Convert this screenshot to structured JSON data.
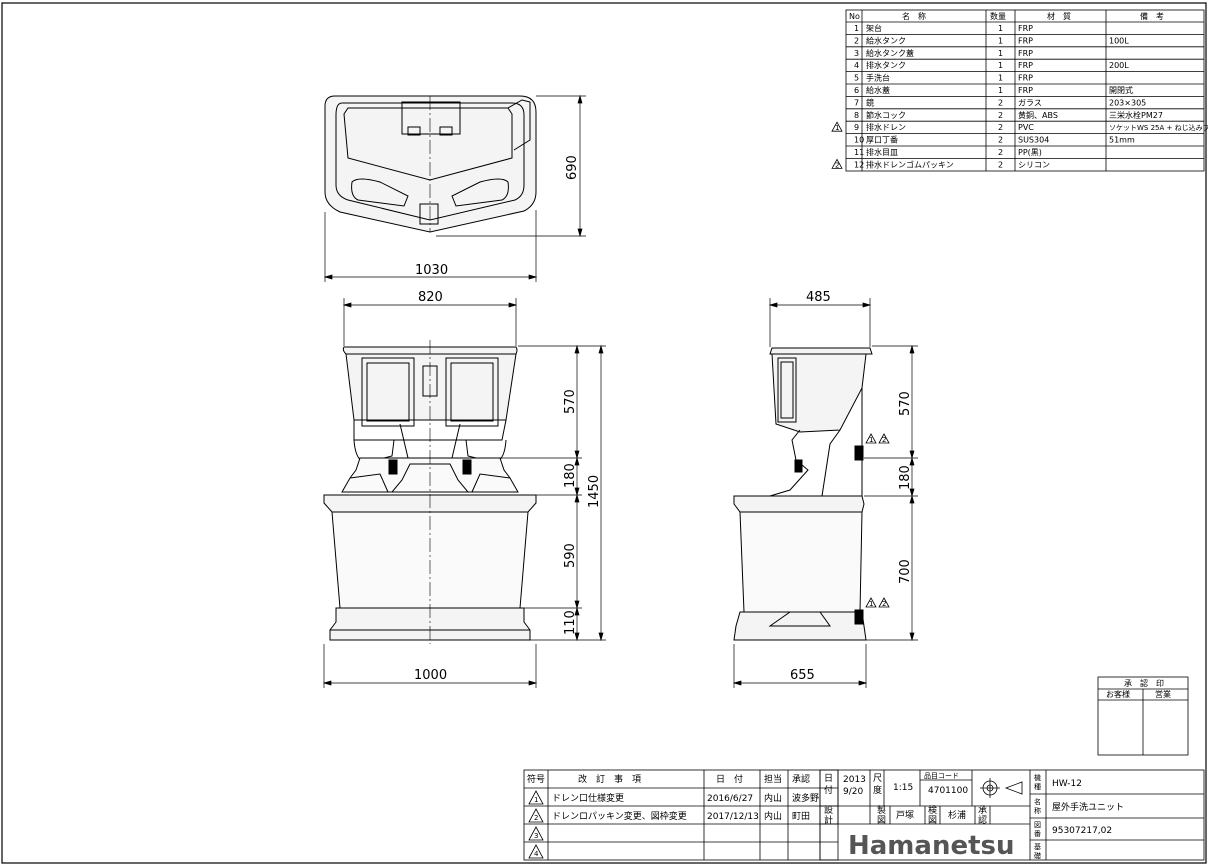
{
  "parts_table": {
    "headers": [
      "No",
      "名　称",
      "数量",
      "材　質",
      "備　考"
    ],
    "rows": [
      {
        "no": "1",
        "name": "架台",
        "qty": "1",
        "material": "FRP",
        "note": "",
        "rev": ""
      },
      {
        "no": "2",
        "name": "給水タンク",
        "qty": "1",
        "material": "FRP",
        "note": "100L",
        "rev": ""
      },
      {
        "no": "3",
        "name": "給水タンク蓋",
        "qty": "1",
        "material": "FRP",
        "note": "",
        "rev": ""
      },
      {
        "no": "4",
        "name": "排水タンク",
        "qty": "1",
        "material": "FRP",
        "note": "200L",
        "rev": ""
      },
      {
        "no": "5",
        "name": "手洗台",
        "qty": "1",
        "material": "FRP",
        "note": "",
        "rev": ""
      },
      {
        "no": "6",
        "name": "給水蓋",
        "qty": "1",
        "material": "FRP",
        "note": "開閉式",
        "rev": ""
      },
      {
        "no": "7",
        "name": "鏡",
        "qty": "2",
        "material": "ガラス",
        "note": "203×305",
        "rev": ""
      },
      {
        "no": "8",
        "name": "節水コック",
        "qty": "2",
        "material": "黄銅、ABS",
        "note": "三栄水栓PM27",
        "rev": ""
      },
      {
        "no": "9",
        "name": "排水ドレン",
        "qty": "2",
        "material": "PVC",
        "note": "ソケットWS 25A + ねじ込みプラグ25A",
        "rev": "1"
      },
      {
        "no": "10",
        "name": "厚口丁番",
        "qty": "2",
        "material": "SUS304",
        "note": "51mm",
        "rev": ""
      },
      {
        "no": "11",
        "name": "排水目皿",
        "qty": "2",
        "material": "PP(黒)",
        "note": "",
        "rev": ""
      },
      {
        "no": "12",
        "name": "排水ドレンゴムパッキン",
        "qty": "2",
        "material": "シリコン",
        "note": "",
        "rev": "2"
      }
    ]
  },
  "dimensions": {
    "top_width": "1030",
    "top_depth": "690",
    "front_upper_width": "820",
    "front_base_width": "1000",
    "side_upper_depth": "485",
    "side_base_depth": "655",
    "h_upper": "570",
    "h_basin": "180",
    "h_lower": "590",
    "h_base": "110",
    "h_total": "1450",
    "side_h_upper": "570",
    "side_h_basin": "180",
    "side_h_lower": "700"
  },
  "approval_box": {
    "title": "承　認　印",
    "col_customer": "お客様",
    "col_sales": "営業"
  },
  "revision_table": {
    "headers": {
      "symbol": "符号",
      "content": "改　訂　事　項",
      "date": "日　付",
      "person": "担当",
      "approver": "承認"
    },
    "rows": [
      {
        "symbol": "1",
        "content": "ドレン口仕様変更",
        "date": "2016/6/27",
        "person": "内山",
        "approver": "波多野"
      },
      {
        "symbol": "2",
        "content": "ドレンロパッキン変更、図枠変更",
        "date": "2017/12/13",
        "person": "内山",
        "approver": "町田"
      },
      {
        "symbol": "3",
        "content": "",
        "date": "",
        "person": "",
        "approver": ""
      },
      {
        "symbol": "4",
        "content": "",
        "date": "",
        "person": "",
        "approver": ""
      }
    ]
  },
  "title_block": {
    "date_label_1": "日",
    "date_label_2": "付",
    "date_year": "2013",
    "date_md": "9/20",
    "scale_label_1": "尺",
    "scale_label_2": "度",
    "scale_value": "1:15",
    "code_label": "品目コード",
    "code_value": "4701100",
    "design_label_1": "設",
    "design_label_2": "計",
    "draw_label_1": "製",
    "draw_label_2": "図",
    "drafter": "戸塚",
    "check_label_1": "検",
    "check_label_2": "図",
    "checker": "杉浦",
    "approve_label_1": "承",
    "approve_label_2": "認",
    "model_label_1": "機",
    "model_label_2": "種",
    "model_value": "HW-12",
    "name_label_1": "名",
    "name_label_2": "称",
    "name_value": "屋外手洗ユニット",
    "drawing_no_label_1": "図",
    "drawing_no_label_2": "番",
    "drawing_no_value": "95307217,02",
    "basis_label_1": "基",
    "basis_label_2": "礎",
    "company": "Hamanetsu"
  },
  "callouts": {
    "rev_mark_1": "1",
    "rev_mark_2": "2"
  },
  "colors": {
    "line": "#000000",
    "background": "#ffffff",
    "body_fill": "#f4f4f4",
    "shade": "#d8d8d8"
  }
}
